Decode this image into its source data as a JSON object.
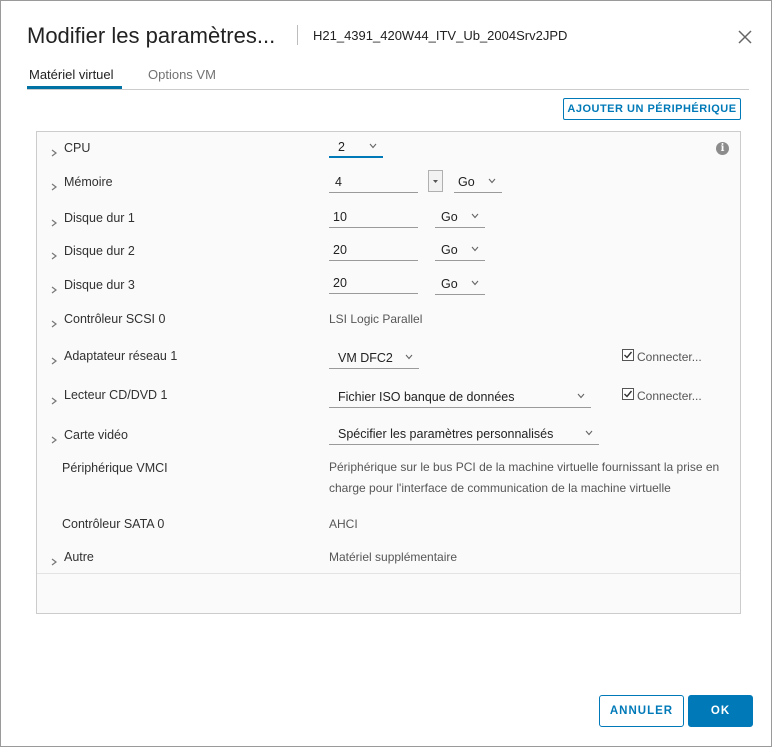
{
  "dialog": {
    "title": "Modifier les paramètres...",
    "vm_name": "H21_4391_420W44_ITV_Ub_2004Srv2JPD"
  },
  "tabs": [
    {
      "label": "Matériel virtuel",
      "active": true
    },
    {
      "label": "Options VM",
      "active": false
    }
  ],
  "add_device_label": "AJOUTER UN PÉRIPHÉRIQUE",
  "rows": {
    "cpu": {
      "label": "CPU",
      "value": "2"
    },
    "memory": {
      "label": "Mémoire",
      "value": "4",
      "unit": "Go"
    },
    "disk1": {
      "label": "Disque dur 1",
      "value": "10",
      "unit": "Go"
    },
    "disk2": {
      "label": "Disque dur 2",
      "value": "20",
      "unit": "Go"
    },
    "disk3": {
      "label": "Disque dur 3",
      "value": "20",
      "unit": "Go"
    },
    "scsi": {
      "label": "Contrôleur SCSI 0",
      "value": "LSI Logic Parallel"
    },
    "network": {
      "label": "Adaptateur réseau 1",
      "value": "VM DFC2",
      "connect_label": "Connecter...",
      "connected": true
    },
    "cdrom": {
      "label": "Lecteur CD/DVD 1",
      "value": "Fichier ISO banque de données",
      "connect_label": "Connecter...",
      "connected": true
    },
    "video": {
      "label": "Carte vidéo",
      "value": "Spécifier les paramètres personnalisés"
    },
    "vmci": {
      "label": "Périphérique VMCI",
      "value": "Périphérique sur le bus PCI de la machine virtuelle fournissant la prise en charge pour l'interface de communication de la machine virtuelle"
    },
    "sata": {
      "label": "Contrôleur SATA 0",
      "value": "AHCI"
    },
    "other": {
      "label": "Autre",
      "value": "Matériel supplémentaire"
    }
  },
  "buttons": {
    "cancel": "ANNULER",
    "ok": "OK"
  },
  "colors": {
    "accent": "#0079b8",
    "cpu_underline": "#0079b8"
  }
}
